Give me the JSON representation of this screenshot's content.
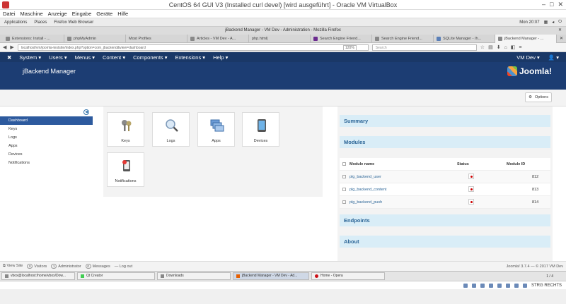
{
  "vbox": {
    "title": "CentOS 64 GUI V3 (Installed curl devel) [wird ausgeführt] - Oracle VM VirtualBox",
    "menu": [
      "Datei",
      "Maschine",
      "Anzeige",
      "Eingabe",
      "Geräte",
      "Hilfe"
    ],
    "win_buttons": [
      "–",
      "□",
      "✕"
    ],
    "status_right": "STRG RECHTS"
  },
  "gnome": {
    "applications": "Applications",
    "places": "Places",
    "app": "Firefox Web Browser",
    "clock": "Mon 20:07"
  },
  "firefox": {
    "window_title": "jBackend Manager - VM Dev - Administration - Mozilla Firefox",
    "tabs": [
      {
        "label": "Extensions: Install - ..."
      },
      {
        "label": "phpMyAdmin"
      },
      {
        "label": "Most Profiles"
      },
      {
        "label": "Articles - VM Dev - A..."
      },
      {
        "label": "php.html|"
      },
      {
        "label": "Search Engine Friend..."
      },
      {
        "label": "Search Engine Friend..."
      },
      {
        "label": "SQLite Manager - /h..."
      },
      {
        "label": "jBackend Manager - ..."
      }
    ],
    "url": "localhost/vm/joomla-testsite/index.php?option=com_jbackend&view=dashboard",
    "zoom": "120%",
    "search_placeholder": "Search"
  },
  "joomla": {
    "top_menu": [
      "System",
      "Users",
      "Menus",
      "Content",
      "Components",
      "Extensions",
      "Help"
    ],
    "user_menu": "VM Dev",
    "user_icon": "user-icon",
    "page_title": "jBackend Manager",
    "logo_text": "Joomla!",
    "options_label": "Options",
    "sidebar": [
      "Dashboard",
      "Keys",
      "Logs",
      "Apps",
      "Devices",
      "Notifications"
    ],
    "tiles": [
      {
        "label": "Keys",
        "icon": "keys-icon"
      },
      {
        "label": "Logs",
        "icon": "magnifier-icon"
      },
      {
        "label": "Apps",
        "icon": "windows-icon"
      },
      {
        "label": "Devices",
        "icon": "tablet-icon"
      },
      {
        "label": "Notifications",
        "icon": "phone-notification-icon"
      }
    ],
    "panels": {
      "summary": "Summary",
      "modules": "Modules",
      "endpoints": "Endpoints",
      "about": "About"
    },
    "modules_table": {
      "headers": [
        "Module name",
        "Status",
        "Module ID"
      ],
      "rows": [
        {
          "name": "plg_backend_user",
          "id": "812"
        },
        {
          "name": "plg_backend_content",
          "id": "813"
        },
        {
          "name": "plg_backend_push",
          "id": "814"
        }
      ]
    },
    "footer": {
      "view_site": "View Site",
      "visitors_count": "0",
      "visitors": "Visitors",
      "admin_count": "1",
      "admin": "Administrator",
      "messages_count": "0",
      "messages": "Messages",
      "logout": "Log out",
      "version": "Joomla! 3.7.4 — © 2017 VM Dev"
    }
  },
  "taskbar": {
    "items": [
      {
        "label": "vbox@localhost:/home/vbox/Dow..."
      },
      {
        "label": "Qt Creator"
      },
      {
        "label": "Downloads"
      },
      {
        "label": "jBackend Manager - VM Dev - Ad..."
      },
      {
        "label": "Home - Opera"
      }
    ],
    "workspace": "1 / 4"
  }
}
